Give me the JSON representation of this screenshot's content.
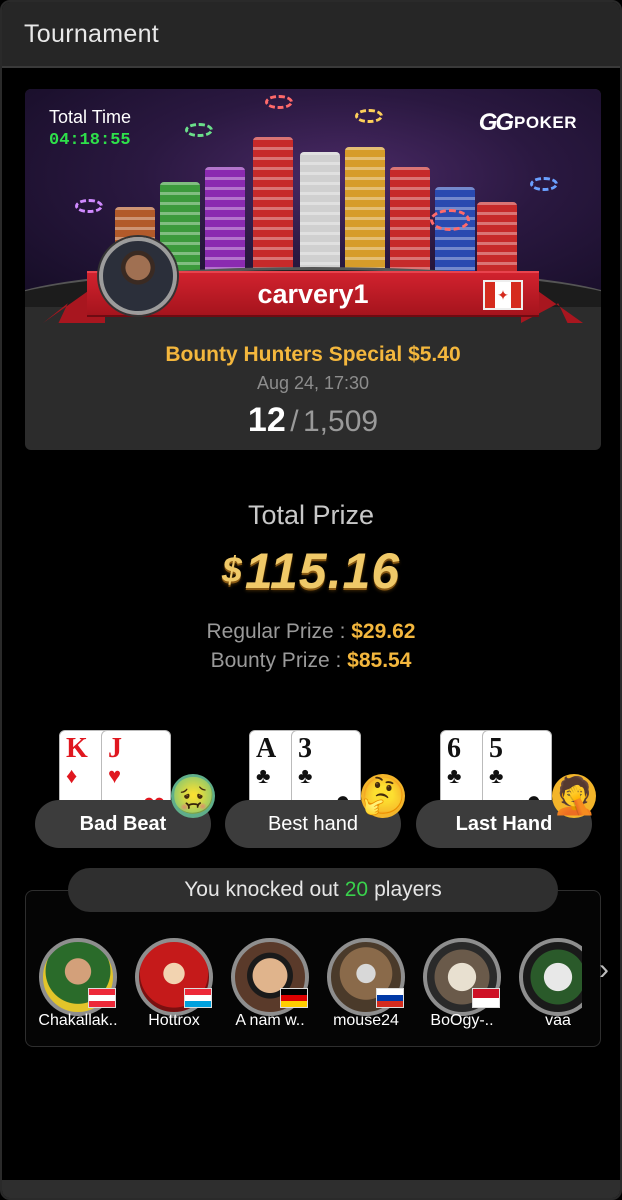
{
  "window": {
    "title": "Tournament"
  },
  "banner": {
    "total_time_label": "Total Time",
    "total_time": "04:18:55",
    "brand_main": "GG",
    "brand_sub": "POKER",
    "username": "carvery1",
    "country_flag": "flag-canada-icon"
  },
  "tournament": {
    "name": "Bounty Hunters Special $5.40",
    "date": "Aug 24, 17:30",
    "place": "12",
    "separator": "/",
    "field_size": "1,509"
  },
  "prize": {
    "label": "Total Prize",
    "currency": "$",
    "total": "115.16",
    "regular_label": "Regular Prize :",
    "regular_amount": "$29.62",
    "bounty_label": "Bounty Prize :",
    "bounty_amount": "$85.54"
  },
  "hands": [
    {
      "label": "Bad Beat",
      "cards": [
        {
          "rank": "K",
          "suit": "♦",
          "color": "red"
        },
        {
          "rank": "J",
          "suit": "♥",
          "color": "red"
        }
      ],
      "emoji": "sick-face-icon"
    },
    {
      "label": "Best hand",
      "cards": [
        {
          "rank": "A",
          "suit": "♣",
          "color": "black"
        },
        {
          "rank": "3",
          "suit": "♣",
          "color": "black"
        }
      ],
      "emoji": "thinking-face-icon"
    },
    {
      "label": "Last Hand",
      "cards": [
        {
          "rank": "6",
          "suit": "♣",
          "color": "black"
        },
        {
          "rank": "5",
          "suit": "♣",
          "color": "black"
        }
      ],
      "emoji": "facepalm-face-icon"
    }
  ],
  "knockouts": {
    "prefix": "You knocked out",
    "count": "20",
    "suffix": "players",
    "players": [
      {
        "name": "Chakallak..",
        "flag": "flag-austria-icon"
      },
      {
        "name": "Hottrox",
        "flag": "flag-luxembourg-icon"
      },
      {
        "name": "A nam w..",
        "flag": "flag-germany-icon"
      },
      {
        "name": "mouse24",
        "flag": "flag-russia-icon"
      },
      {
        "name": "BoOgy-..",
        "flag": "flag-indonesia-icon"
      },
      {
        "name": "vaa",
        "flag": ""
      }
    ]
  },
  "colors": {
    "accent_gold": "#f4b73d",
    "timer_green": "#2ee04a",
    "count_green": "#39d14c",
    "ribbon_red": "#c41d28"
  }
}
